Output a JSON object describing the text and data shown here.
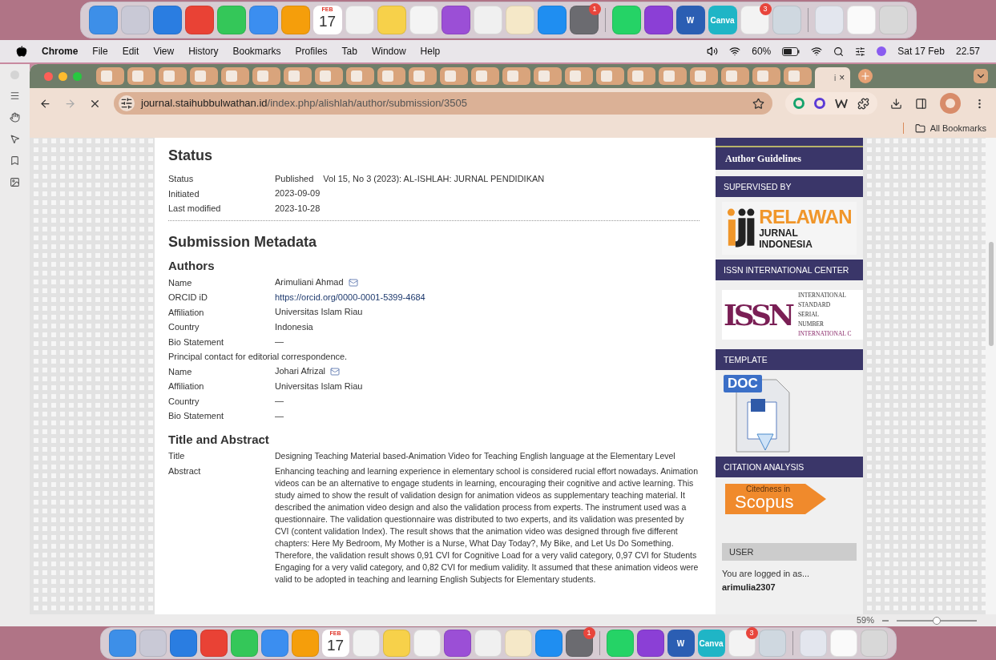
{
  "dock_top": [
    {
      "kind": "app",
      "color": "#3d8fe8"
    },
    {
      "kind": "app",
      "color": "#c9c9d6"
    },
    {
      "kind": "app",
      "color": "#2a7de1"
    },
    {
      "kind": "app",
      "color": "#e94235"
    },
    {
      "kind": "app",
      "color": "#34c759"
    },
    {
      "kind": "app",
      "color": "#3b8ef0"
    },
    {
      "kind": "app",
      "color": "#f59e0b"
    },
    {
      "kind": "calendar",
      "month": "FEB",
      "day": "17"
    },
    {
      "kind": "app",
      "color": "#f2f2f2"
    },
    {
      "kind": "app",
      "color": "#f7d14a"
    },
    {
      "kind": "app",
      "color": "#f4f4f4"
    },
    {
      "kind": "app",
      "color": "#9b4fd6"
    },
    {
      "kind": "app",
      "color": "#f0f0f0"
    },
    {
      "kind": "app",
      "color": "#f5e8c8"
    },
    {
      "kind": "app",
      "color": "#1f8ef1"
    },
    {
      "kind": "app",
      "color": "#6b6b70",
      "badge": "1"
    },
    {
      "kind": "separator"
    },
    {
      "kind": "app",
      "color": "#25d366"
    },
    {
      "kind": "app",
      "color": "#8b3fd6"
    },
    {
      "kind": "label",
      "color": "#2b5eb3",
      "label": "W"
    },
    {
      "kind": "label",
      "color": "#1fb5c6",
      "label": "Canva"
    },
    {
      "kind": "app",
      "color": "#f3f3f3",
      "badge": "3"
    },
    {
      "kind": "app",
      "color": "#cfd8e0"
    },
    {
      "kind": "separator"
    },
    {
      "kind": "app",
      "color": "#e3e6ee"
    },
    {
      "kind": "app",
      "color": "#fafafa"
    },
    {
      "kind": "app",
      "color": "#d8d8d8"
    }
  ],
  "menu_bar": {
    "app": "Chrome",
    "items": [
      "File",
      "Edit",
      "View",
      "History",
      "Bookmarks",
      "Profiles",
      "Tab",
      "Window",
      "Help"
    ],
    "battery": "60%",
    "date": "Sat 17 Feb",
    "time": "22.57"
  },
  "tabs": [
    {
      "selected": false
    },
    {
      "selected": false
    },
    {
      "selected": false
    },
    {
      "selected": false
    },
    {
      "selected": false
    },
    {
      "selected": false
    },
    {
      "selected": false
    },
    {
      "selected": false
    },
    {
      "selected": false
    },
    {
      "selected": false
    },
    {
      "selected": false
    },
    {
      "selected": false
    },
    {
      "selected": false
    },
    {
      "selected": false
    },
    {
      "selected": false
    },
    {
      "selected": false
    },
    {
      "selected": false
    },
    {
      "selected": false
    },
    {
      "selected": false
    },
    {
      "selected": false
    },
    {
      "selected": false
    },
    {
      "selected": false
    },
    {
      "selected": false
    },
    {
      "selected": true,
      "label": "i",
      "close": "×"
    }
  ],
  "address": {
    "host": "journal.staihubbulwathan.id",
    "path": "/index.php/alishlah/author/submission/3505"
  },
  "bookmarks_bar": {
    "all": "All Bookmarks"
  },
  "status_section": {
    "heading": "Status",
    "rows": [
      {
        "kind": "field",
        "label": "Status",
        "value": "Published",
        "extra": "Vol 15, No 3 (2023): AL-ISHLAH: JURNAL PENDIDIKAN"
      },
      {
        "kind": "field",
        "label": "Initiated",
        "value": "2023-09-09"
      },
      {
        "kind": "field",
        "label": "Last modified",
        "value": "2023-10-28"
      }
    ]
  },
  "metadata": {
    "heading": "Submission Metadata",
    "authors_heading": "Authors",
    "authors": [
      {
        "kind": "field",
        "label": "Name",
        "value": "Arimuliani Ahmad",
        "email": true
      },
      {
        "kind": "link",
        "label": "ORCID iD",
        "value": "https://orcid.org/0000-0001-5399-4684"
      },
      {
        "kind": "field",
        "label": "Affiliation",
        "value": "Universitas Islam Riau"
      },
      {
        "kind": "field",
        "label": "Country",
        "value": "Indonesia"
      },
      {
        "kind": "field",
        "label": "Bio Statement",
        "value": "—"
      },
      {
        "kind": "note",
        "value": "Principal contact for editorial correspondence."
      },
      {
        "kind": "field",
        "label": "Name",
        "value": "Johari Afrizal",
        "email": true
      },
      {
        "kind": "field",
        "label": "Affiliation",
        "value": "Universitas Islam Riau"
      },
      {
        "kind": "field",
        "label": "Country",
        "value": "—"
      },
      {
        "kind": "field",
        "label": "Bio Statement",
        "value": "—"
      }
    ],
    "abstract_heading": "Title and Abstract",
    "abstract_rows": [
      {
        "kind": "field",
        "label": "Title",
        "value": "Designing Teaching Material based-Animation Video for Teaching English language at the Elementary Level"
      },
      {
        "kind": "field",
        "label": "Abstract",
        "value": "Enhancing teaching and learning experience in elementary school is considered rucial effort nowadays. Animation videos can be an alternative to engage students in learning, encouraging their cognitive and active learning. This study aimed to show the result of validation design for animation videos as supplementary teaching material. It described the animation video design and also the validation process from experts. The instrument used was a questionnaire. The validation questionnaire was distributed to two experts, and its validation was presented by CVI (content validation Index). The result shows that the animation video was designed through five different chapters: Here My Bedroom, My Mother is a Nurse, What Day Today?, My Bike, and Let Us Do Something. Therefore, the validation result shows 0,91 CVI for Cognitive Load for a very valid category, 0,97 CVI for Students Engaging for a very valid category, and 0,82 CVI for medium validity. It assumed that these animation videos were valid to be adopted in teaching and learning English Subjects for Elementary students."
      }
    ]
  },
  "sidebar": {
    "link": "Author Guidelines",
    "blocks": [
      {
        "kind": "relawan",
        "heading": "SUPERVISED BY",
        "title": "RELAWAN",
        "subtitle": "JURNAL INDONESIA"
      },
      {
        "kind": "issn",
        "heading": "ISSN INTERNATIONAL CENTER",
        "title": "ISSN",
        "lines": [
          "INTERNATIONAL",
          "STANDARD",
          "SERIAL",
          "NUMBER",
          "INTERNATIONAL C"
        ]
      },
      {
        "kind": "doc",
        "heading": "TEMPLATE",
        "title": "DOC"
      },
      {
        "kind": "scopus",
        "heading": "CITATION ANALYSIS",
        "title": "Citedness in",
        "subtitle": "Scopus"
      }
    ],
    "user": {
      "heading": "USER",
      "text": "You are logged in as...",
      "name": "arimulia2307"
    }
  },
  "word_status": {
    "zoom": "59%",
    "level": 0.5
  },
  "dock_bottom": [
    {
      "kind": "app",
      "color": "#3d8fe8"
    },
    {
      "kind": "app",
      "color": "#c9c9d6"
    },
    {
      "kind": "app",
      "color": "#2a7de1"
    },
    {
      "kind": "app",
      "color": "#e94235"
    },
    {
      "kind": "app",
      "color": "#34c759"
    },
    {
      "kind": "app",
      "color": "#3b8ef0"
    },
    {
      "kind": "app",
      "color": "#f59e0b"
    },
    {
      "kind": "calendar",
      "month": "FEB",
      "day": "17"
    },
    {
      "kind": "app",
      "color": "#f2f2f2"
    },
    {
      "kind": "app",
      "color": "#f7d14a"
    },
    {
      "kind": "app",
      "color": "#f4f4f4"
    },
    {
      "kind": "app",
      "color": "#9b4fd6"
    },
    {
      "kind": "app",
      "color": "#f0f0f0"
    },
    {
      "kind": "app",
      "color": "#f5e8c8"
    },
    {
      "kind": "app",
      "color": "#1f8ef1"
    },
    {
      "kind": "app",
      "color": "#6b6b70",
      "badge": "1"
    },
    {
      "kind": "separator"
    },
    {
      "kind": "app",
      "color": "#25d366"
    },
    {
      "kind": "app",
      "color": "#8b3fd6"
    },
    {
      "kind": "label",
      "color": "#2b5eb3",
      "label": "W"
    },
    {
      "kind": "label",
      "color": "#1fb5c6",
      "label": "Canva"
    },
    {
      "kind": "app",
      "color": "#f3f3f3",
      "badge": "3"
    },
    {
      "kind": "app",
      "color": "#cfd8e0"
    },
    {
      "kind": "separator"
    },
    {
      "kind": "app",
      "color": "#e3e6ee"
    },
    {
      "kind": "app",
      "color": "#fafafa"
    },
    {
      "kind": "app",
      "color": "#d8d8d8"
    }
  ]
}
